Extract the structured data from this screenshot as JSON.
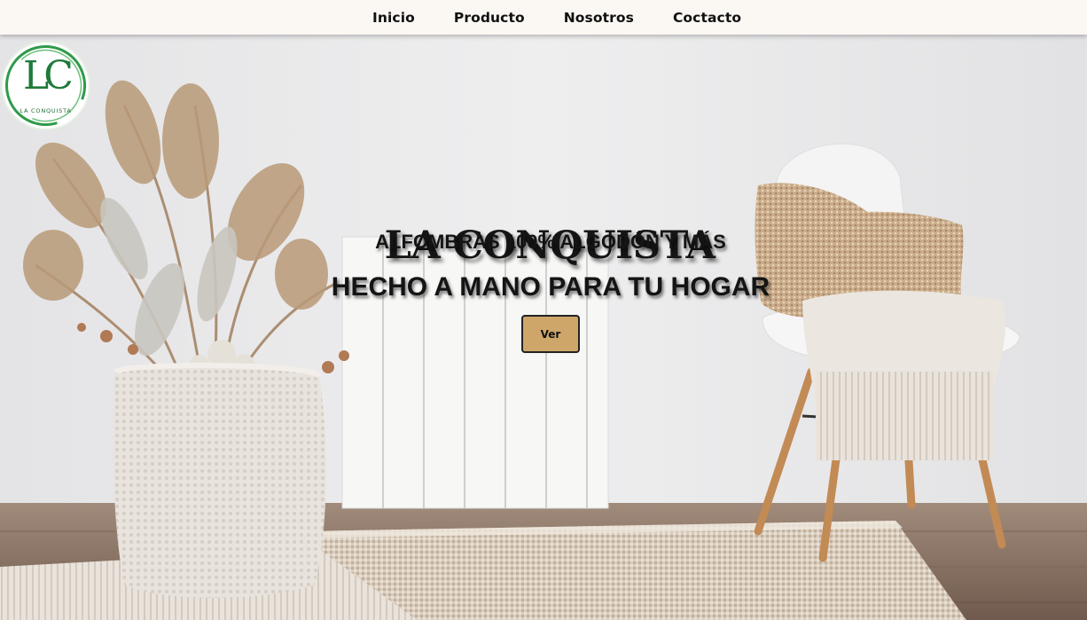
{
  "nav": {
    "items": [
      {
        "label": "Inicio"
      },
      {
        "label": "Producto"
      },
      {
        "label": "Nosotros"
      },
      {
        "label": "Coctacto"
      }
    ]
  },
  "logo": {
    "monogram": "LC",
    "brand": "LA CONQUISTA"
  },
  "hero": {
    "title": "LA CONQUISTA",
    "subtitle": "ALFOMBRAS 100% ALGODÓN Y MÁS",
    "tagline": "HECHO A MANO PARA TU HOGAR",
    "button_label": "Ver"
  },
  "colors": {
    "nav_bg": "#fbf7f3",
    "button_bg": "#cfa66a",
    "logo_green": "#1f7a3a",
    "wall": "#eceae8",
    "floor": "#8c7565"
  }
}
